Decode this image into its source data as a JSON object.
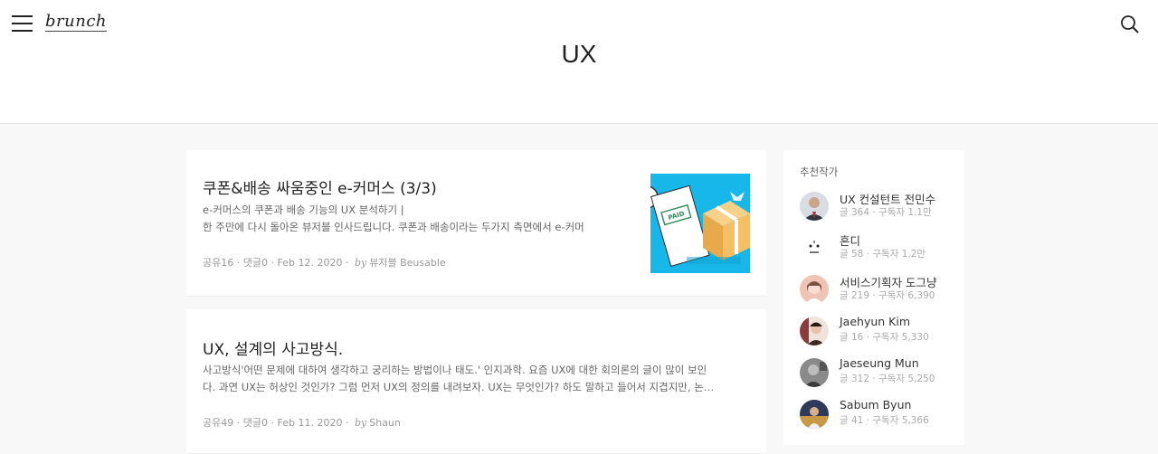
{
  "header": {
    "logo": "brunch",
    "page_title": "UX"
  },
  "articles": [
    {
      "title": "쿠폰&배송 싸움중인 e-커머스 (3/3)",
      "sub1": "e-커머스의 쿠폰과 배송 기능의 UX 분석하기  |",
      "sub2": "한 주만에 다시 돌아온 뷰저블 인사드립니다. 쿠폰과 배송이라는 두가지 측면에서 e-커머",
      "shares": "공유16",
      "comments": "댓글0",
      "date": "Feb 12. 2020",
      "by": "by",
      "author": "뷰저블 Beusable",
      "thumb_badge": "PAID"
    },
    {
      "title": "UX, 설계의 사고방식.",
      "sub1": "사고방식'어떤 문제에 대하여 생각하고 궁리하는 방법이나 태도.' 인지과학. 요즘 UX에 대한 회의론의 글이 많이 보인",
      "sub2": "다. 과연 UX는 허상인 것인가? 그럼 먼저 UX의 정의를 내려보자. UX는 무엇인가? 하도 말하고 들어서 지겹지만, 논…",
      "shares": "공유49",
      "comments": "댓글0",
      "date": "Feb 11. 2020",
      "by": "by",
      "author": "Shaun"
    }
  ],
  "sidebar": {
    "heading": "추천작가",
    "authors": [
      {
        "name": "UX 컨설턴트 전민수",
        "stats": "글 364 · 구독자 1.1만",
        "avatar_color": "#5a6a7a"
      },
      {
        "name": "흔디",
        "stats": "글 58 · 구독자 1.2만",
        "avatar_color": "#f2f2f2"
      },
      {
        "name": "서비스기획자 도그냥",
        "stats": "글 219 · 구독자 6,390",
        "avatar_color": "#e8b8a8"
      },
      {
        "name": "Jaehyun Kim",
        "stats": "글 16 · 구독자 5,330",
        "avatar_color": "#6b4a3a"
      },
      {
        "name": "Jaeseung Mun",
        "stats": "글 312 · 구독자 5,250",
        "avatar_color": "#666666"
      },
      {
        "name": "Sabum Byun",
        "stats": "글 41 · 구독자 5,366",
        "avatar_color": "#3a4a6a"
      }
    ]
  },
  "colors": {
    "thumb_bg": "#18b7ea",
    "box": "#f5c063"
  },
  "icons": {
    "menu": "hamburger-menu-icon",
    "search": "search-icon"
  }
}
